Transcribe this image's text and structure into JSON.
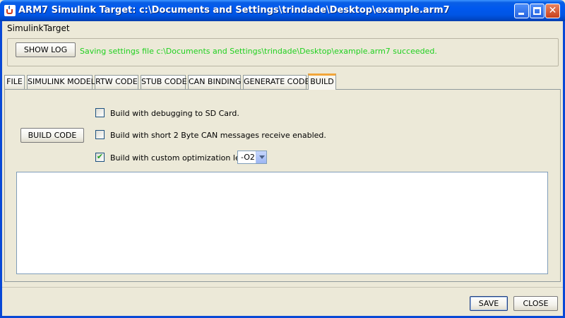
{
  "window": {
    "title": "ARM7 Simulink Target: c:\\Documents and Settings\\trindade\\Desktop\\example.arm7",
    "min_icon": "minimize-icon",
    "max_icon": "maximize-icon",
    "close_icon": "close-icon",
    "close_glyph": "✕"
  },
  "menu": {
    "items": [
      "SimulinkTarget"
    ]
  },
  "top": {
    "show_log_label": "SHOW LOG",
    "status": "Saving settings file c:\\Documents and Settings\\trindade\\Desktop\\example.arm7 succeeded.",
    "status_color": "#1fd01f"
  },
  "tabs": [
    {
      "label": "FILE"
    },
    {
      "label": "SIMULINK MODEL"
    },
    {
      "label": "RTW CODE"
    },
    {
      "label": "STUB CODE"
    },
    {
      "label": "CAN BINDING"
    },
    {
      "label": "GENERATE CODE"
    },
    {
      "label": "BUILD"
    }
  ],
  "active_tab": "BUILD",
  "build": {
    "build_code_label": "BUILD CODE",
    "options": [
      {
        "label": "Build with debugging to SD Card.",
        "checked": false
      },
      {
        "label": "Build with short 2 Byte CAN messages receive enabled.",
        "checked": false
      },
      {
        "label": "Build with custom optimization level:",
        "checked": true
      }
    ],
    "optimization_level": "-O2",
    "output": ""
  },
  "footer": {
    "save_label": "SAVE",
    "close_label": "CLOSE"
  },
  "colors": {
    "titlebar": "#0055e5",
    "active_tab_accent": "#f2a63b",
    "check": "#21a121"
  }
}
